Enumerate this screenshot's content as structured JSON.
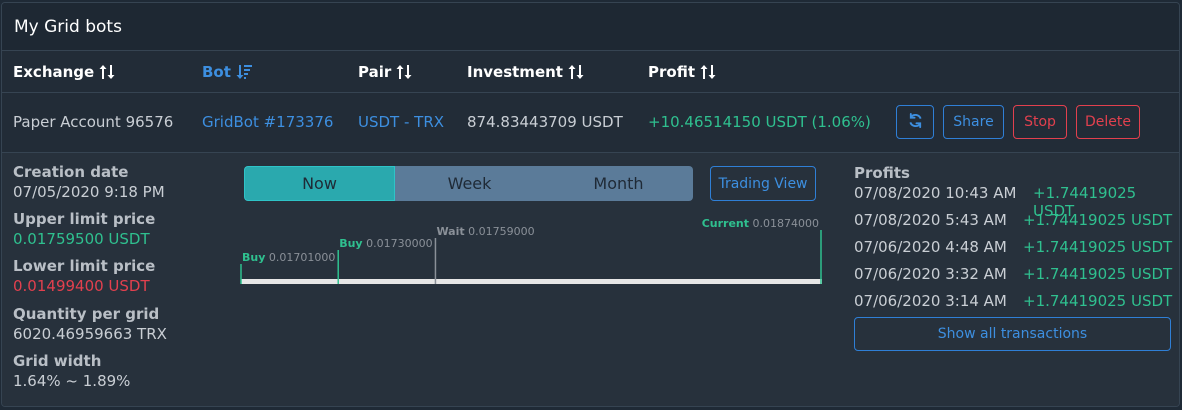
{
  "panel": {
    "title": "My Grid bots"
  },
  "table": {
    "columns": [
      {
        "label": "Exchange"
      },
      {
        "label": "Bot"
      },
      {
        "label": "Pair"
      },
      {
        "label": "Investment"
      },
      {
        "label": "Profit"
      }
    ],
    "row": {
      "exchange": "Paper Account 96576",
      "bot": "GridBot #173376",
      "pair": "USDT - TRX",
      "investment": "874.83443709 USDT",
      "profit": "+10.46514150 USDT (1.06%)"
    },
    "actions": {
      "share": "Share",
      "stop": "Stop",
      "delete": "Delete"
    }
  },
  "details": {
    "creation_label": "Creation date",
    "creation_value": "07/05/2020 9:18 PM",
    "upper_label": "Upper limit price",
    "upper_value": "0.01759500 USDT",
    "lower_label": "Lower limit price",
    "lower_value": "0.01499400 USDT",
    "qty_label": "Quantity per grid",
    "qty_value": "6020.46959663 TRX",
    "width_label": "Grid width",
    "width_value": "1.64% ~ 1.89%"
  },
  "timeframe": {
    "options": [
      "Now",
      "Week",
      "Month"
    ],
    "selected": "Now",
    "trading_view": "Trading View"
  },
  "grid_chart": {
    "markers": [
      {
        "label": "Buy",
        "price": "0.01701000",
        "value": 0.01701
      },
      {
        "label": "Buy",
        "price": "0.01730000",
        "value": 0.0173
      },
      {
        "label": "Wait",
        "price": "0.01759000",
        "value": 0.01759
      },
      {
        "label": "Current",
        "price": "0.01874000",
        "value": 0.01874
      }
    ]
  },
  "profits": {
    "title": "Profits",
    "items": [
      {
        "date": "07/08/2020 10:43 AM",
        "amount": "+1.74419025 USDT"
      },
      {
        "date": "07/08/2020 5:43 AM",
        "amount": "+1.74419025 USDT"
      },
      {
        "date": "07/06/2020 4:48 AM",
        "amount": "+1.74419025 USDT"
      },
      {
        "date": "07/06/2020 3:32 AM",
        "amount": "+1.74419025 USDT"
      },
      {
        "date": "07/06/2020 3:14 AM",
        "amount": "+1.74419025 USDT"
      }
    ],
    "show_all": "Show all transactions"
  },
  "colors": {
    "accent_blue": "#3d8fe0",
    "positive_green": "#2fc08f",
    "negative_red": "#e2404e",
    "segment_active": "#2aa9ae"
  }
}
